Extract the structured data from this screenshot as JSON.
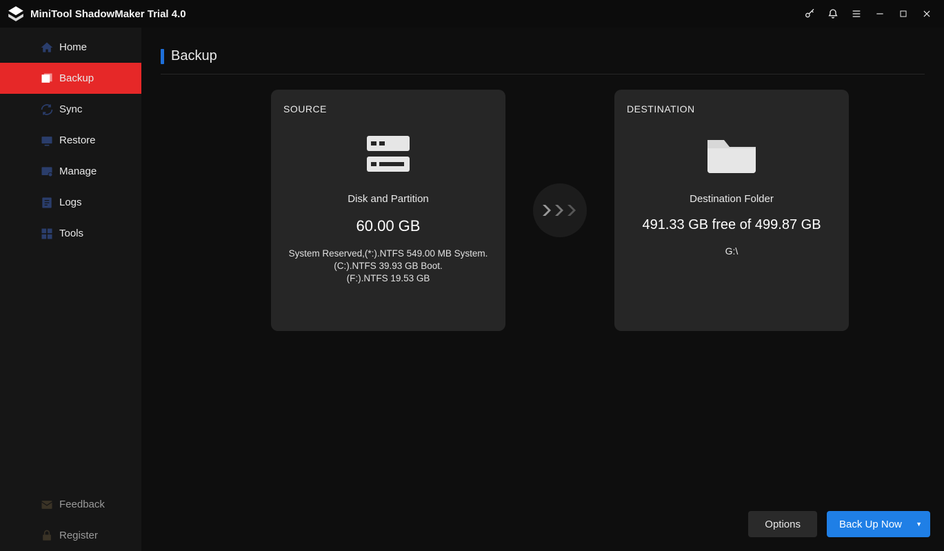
{
  "app": {
    "title": "MiniTool ShadowMaker Trial 4.0"
  },
  "sidebar": {
    "items": [
      {
        "label": "Home"
      },
      {
        "label": "Backup"
      },
      {
        "label": "Sync"
      },
      {
        "label": "Restore"
      },
      {
        "label": "Manage"
      },
      {
        "label": "Logs"
      },
      {
        "label": "Tools"
      }
    ],
    "bottom": [
      {
        "label": "Feedback"
      },
      {
        "label": "Register"
      }
    ]
  },
  "page": {
    "title": "Backup"
  },
  "source": {
    "label": "SOURCE",
    "title": "Disk and Partition",
    "size": "60.00 GB",
    "detail": "System Reserved,(*:).NTFS 549.00 MB System.\n(C:).NTFS 39.93 GB Boot.\n(F:).NTFS 19.53 GB"
  },
  "destination": {
    "label": "DESTINATION",
    "title": "Destination Folder",
    "free": "491.33 GB free of 499.87 GB",
    "path": "G:\\"
  },
  "actions": {
    "options": "Options",
    "backup_now": "Back Up Now"
  }
}
